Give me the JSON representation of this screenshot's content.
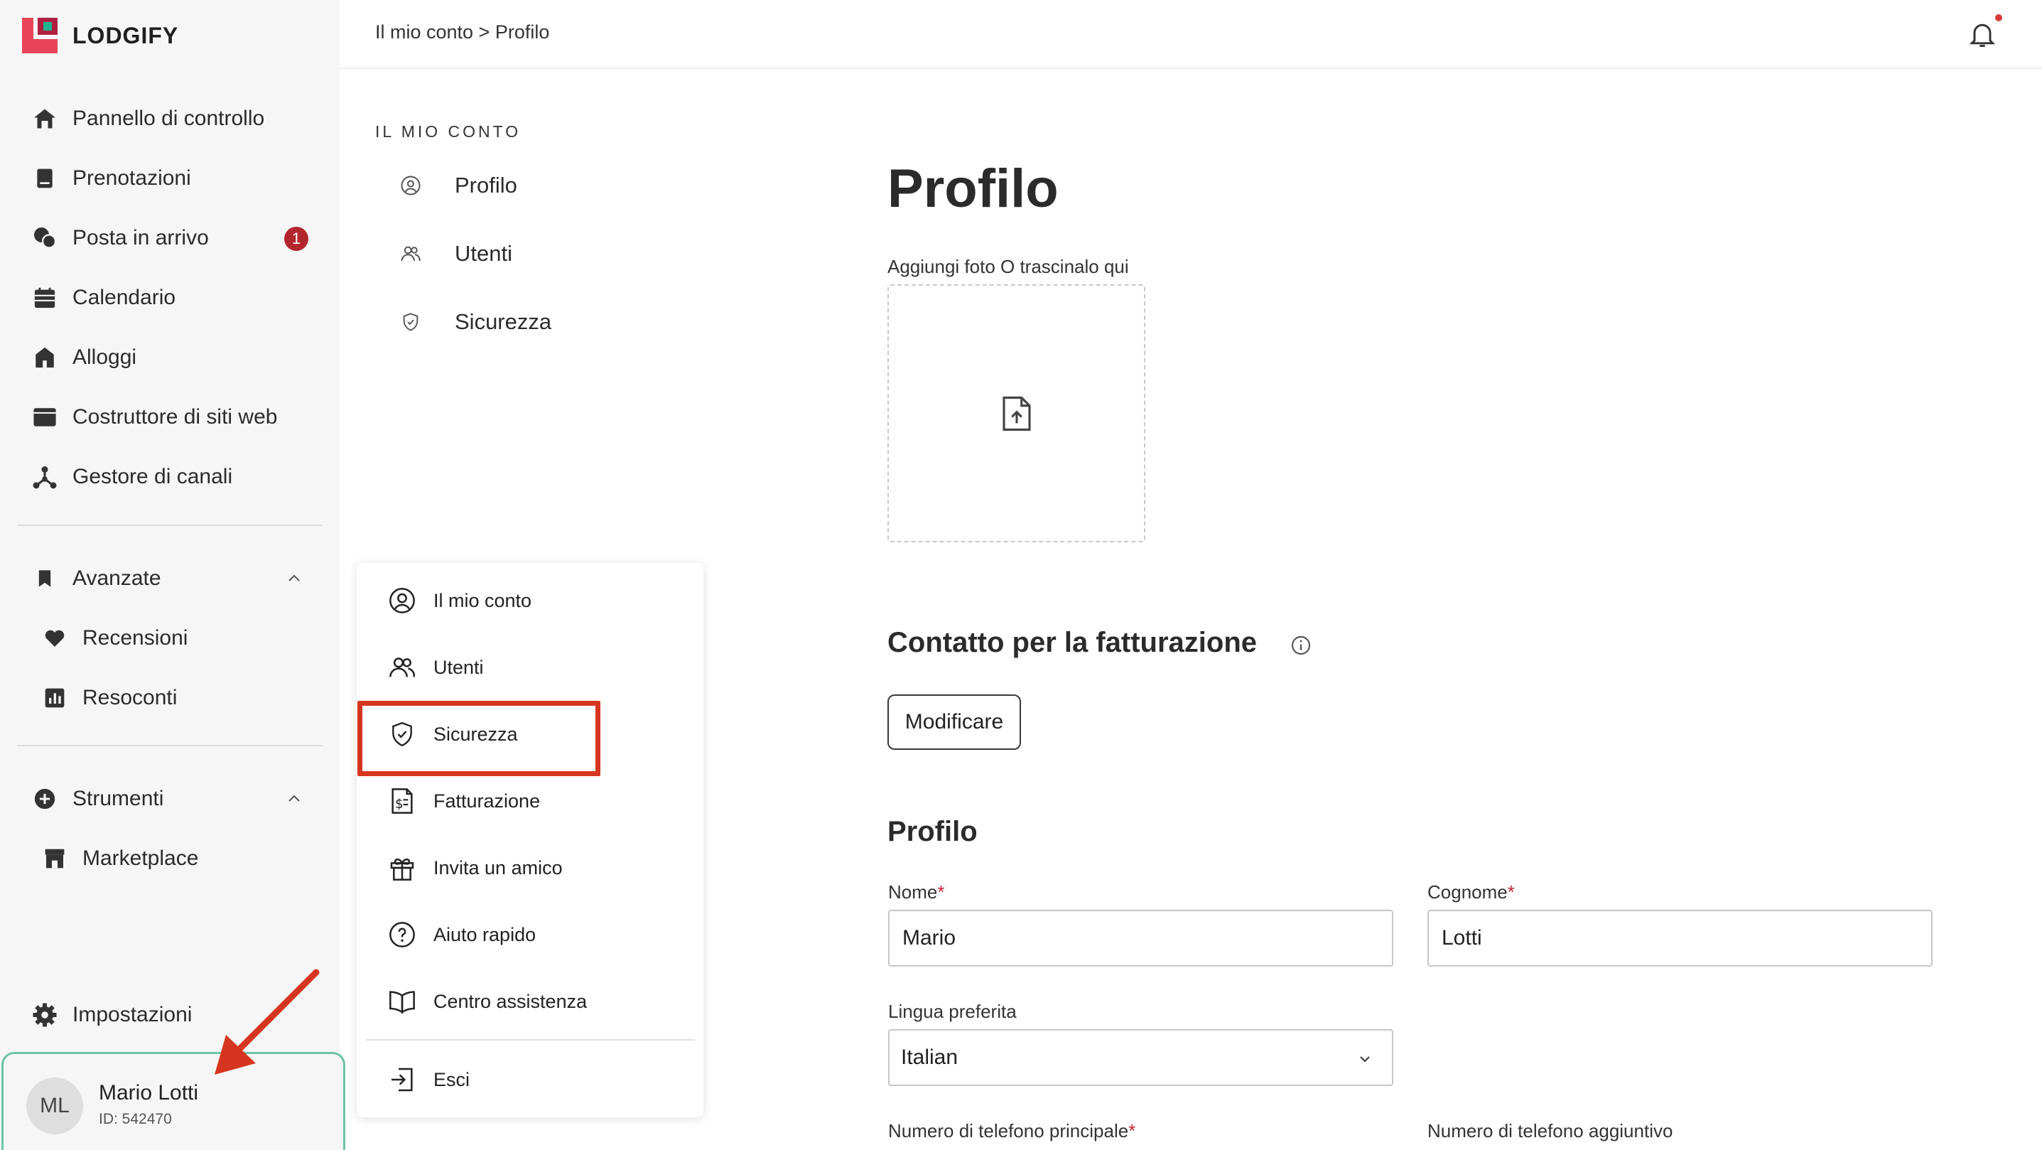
{
  "brand": {
    "name": "LODGIFY",
    "colors": {
      "logo_red": "#e8445a",
      "logo_dark": "#b01f3f",
      "badge": "#b3262e",
      "highlight": "#d6361f",
      "user_border": "#6cc4a6"
    }
  },
  "sidebar": {
    "items": [
      {
        "label": "Pannello di controllo",
        "icon": "home-icon"
      },
      {
        "label": "Prenotazioni",
        "icon": "book-icon"
      },
      {
        "label": "Posta in arrivo",
        "icon": "chat-icon",
        "badge": "1"
      },
      {
        "label": "Calendario",
        "icon": "calendar-icon"
      },
      {
        "label": "Alloggi",
        "icon": "house-icon"
      },
      {
        "label": "Costruttore di siti web",
        "icon": "browser-icon"
      },
      {
        "label": "Gestore di canali",
        "icon": "network-icon"
      }
    ],
    "advanced": {
      "label": "Avanzate",
      "icon": "bookmark-icon",
      "children": [
        {
          "label": "Recensioni",
          "icon": "heart-icon"
        },
        {
          "label": "Resoconti",
          "icon": "chart-icon"
        }
      ]
    },
    "tools": {
      "label": "Strumenti",
      "icon": "plus-circle-icon",
      "children": [
        {
          "label": "Marketplace",
          "icon": "store-icon"
        }
      ]
    },
    "settings": {
      "label": "Impostazioni",
      "icon": "gear-icon"
    },
    "user": {
      "initials": "ML",
      "name": "Mario Lotti",
      "id": "ID: 542470"
    }
  },
  "topbar": {
    "breadcrumb": "Il mio conto > Profilo"
  },
  "account_nav": {
    "title": "IL MIO CONTO",
    "items": [
      {
        "label": "Profilo",
        "icon": "user-circle-icon"
      },
      {
        "label": "Utenti",
        "icon": "users-icon"
      },
      {
        "label": "Sicurezza",
        "icon": "shield-icon"
      }
    ]
  },
  "user_menu": {
    "items": [
      {
        "label": "Il mio conto",
        "icon": "user-circle-icon"
      },
      {
        "label": "Utenti",
        "icon": "users-icon"
      },
      {
        "label": "Sicurezza",
        "icon": "shield-check-icon"
      },
      {
        "label": "Fatturazione",
        "icon": "invoice-icon"
      },
      {
        "label": "Invita un amico",
        "icon": "gift-icon"
      },
      {
        "label": "Aiuto rapido",
        "icon": "help-icon"
      },
      {
        "label": "Centro assistenza",
        "icon": "open-book-icon"
      },
      {
        "label": "Esci",
        "icon": "logout-icon"
      }
    ]
  },
  "main": {
    "title": "Profilo",
    "upload_label": "Aggiungi foto O trascinalo qui",
    "billing": {
      "heading": "Contatto per la fatturazione",
      "edit_button": "Modificare"
    },
    "profile": {
      "heading": "Profilo",
      "first_name": {
        "label": "Nome",
        "required": "*",
        "value": "Mario"
      },
      "last_name": {
        "label": "Cognome",
        "required": "*",
        "value": "Lotti"
      },
      "language": {
        "label": "Lingua preferita",
        "value": "Italian"
      },
      "phone_main": {
        "label": "Numero di telefono principale",
        "required": "*"
      },
      "phone_extra": {
        "label": "Numero di telefono aggiuntivo"
      }
    }
  }
}
